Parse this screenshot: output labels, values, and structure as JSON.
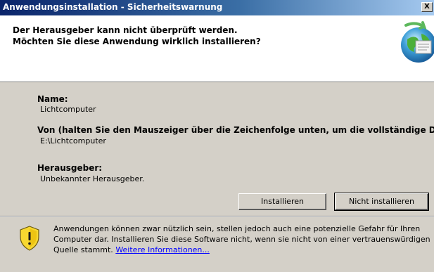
{
  "window": {
    "title": "Anwendungsinstallation - Sicherheitswarnung",
    "close_glyph": "X"
  },
  "header": {
    "line1": "Der Herausgeber kann nicht überprüft werden.",
    "line2": "Möchten Sie diese Anwendung wirklich installieren?",
    "icon": "application-install-globe-icon"
  },
  "details": {
    "name_label": "Name:",
    "name_value": "Lichtcomputer",
    "from_label": "Von (halten Sie den Mauszeiger über die Zeichenfolge unten, um die vollständige D",
    "from_value": "E:\\Lichtcomputer",
    "publisher_label": "Herausgeber:",
    "publisher_value": "Unbekannter Herausgeber."
  },
  "buttons": {
    "install": "Installieren",
    "dont_install": "Nicht installieren"
  },
  "footer": {
    "icon": "warning-shield-icon",
    "text": "Anwendungen können zwar nützlich sein, stellen jedoch auch eine potenzielle Gefahr für Ihren Computer dar. Installieren Sie diese Software nicht, wenn sie nicht von einer vertrauenswürdigen Quelle stammt.",
    "link": "Weitere Informationen..."
  },
  "colors": {
    "titlebar_start": "#0a246a",
    "titlebar_end": "#a6caf0",
    "dialog_face": "#d4d0c8",
    "link": "#0000ff"
  }
}
